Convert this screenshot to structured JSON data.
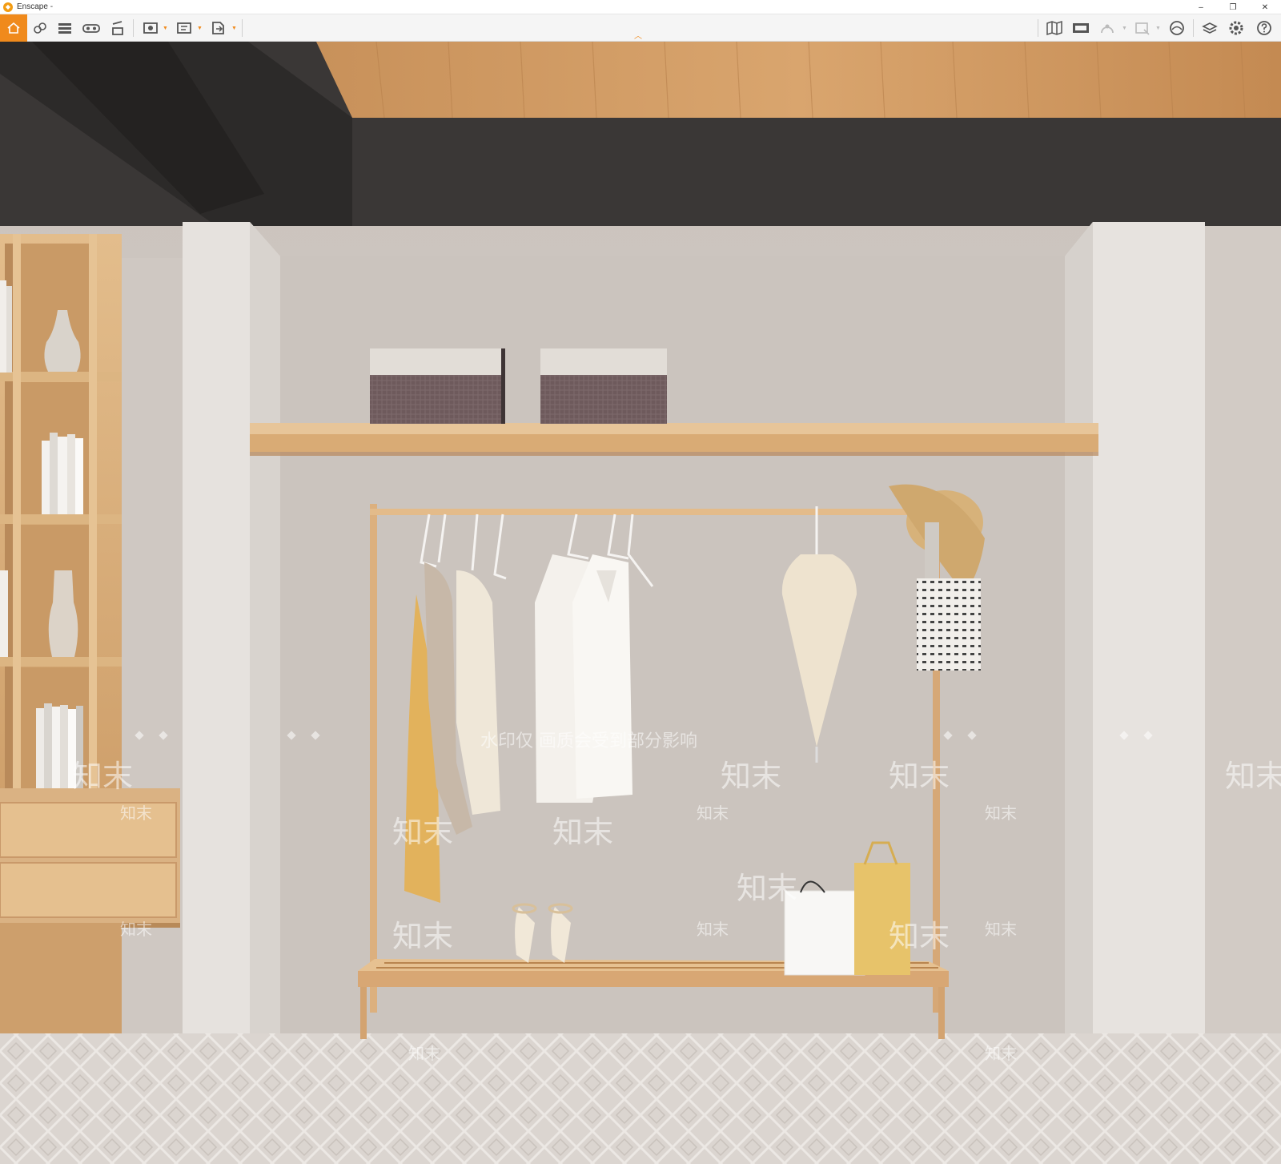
{
  "window": {
    "title": "Enscape -",
    "minimize_label": "–",
    "maximize_label": "❐",
    "close_label": "✕"
  },
  "toolbar": {
    "left_icons": [
      "home-icon",
      "link-icon",
      "asset-library-icon",
      "vr-headset-icon",
      "video-editor-icon",
      "screenshot-icon",
      "batch-render-icon",
      "export-icon"
    ],
    "right_icons": [
      "map-icon",
      "view-management-icon",
      "sun-icon",
      "capture-icon",
      "atmosphere-icon",
      "material-editor-icon",
      "settings-icon",
      "help-icon"
    ],
    "accent_color": "#f08a1c"
  },
  "viewport": {
    "watermark_text": "水印仅 画质会受到部分影响",
    "watermark_brand": "知末"
  }
}
